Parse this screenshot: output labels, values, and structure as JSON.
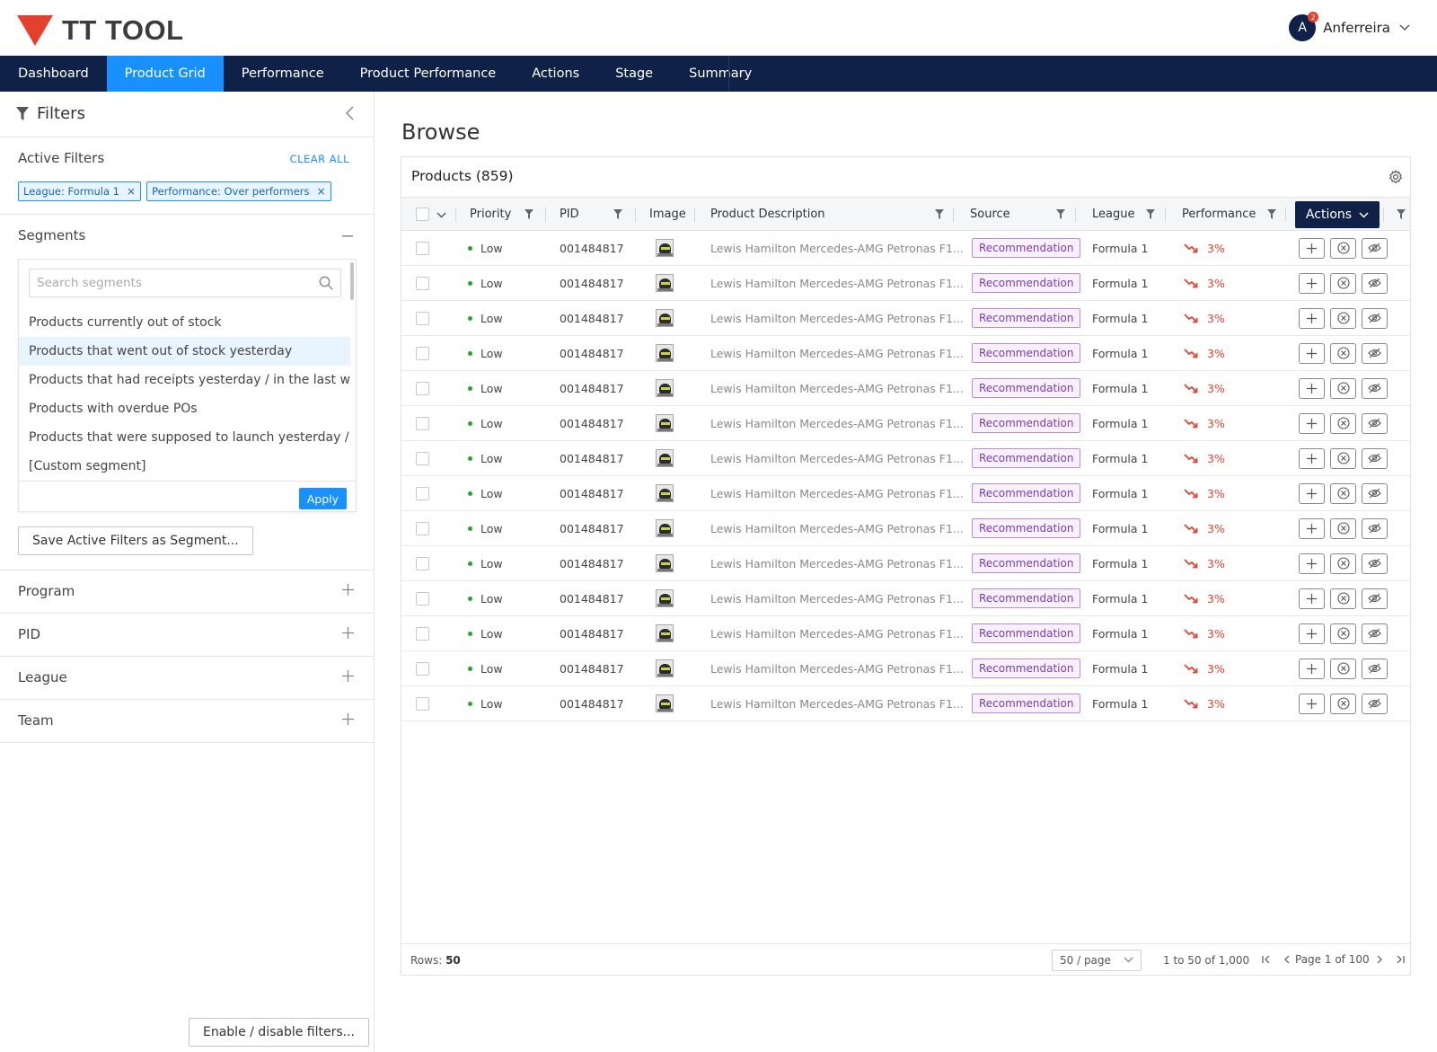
{
  "app": {
    "logo_text": "TT TOOL"
  },
  "user": {
    "initial": "A",
    "name": "Anferreira",
    "notification_count": "2"
  },
  "nav": {
    "items": [
      {
        "label": "Dashboard",
        "active": false
      },
      {
        "label": "Product Grid",
        "active": true
      },
      {
        "label": "Performance",
        "active": false
      },
      {
        "label": "Product Performance",
        "active": false
      },
      {
        "label": "Actions",
        "active": false
      },
      {
        "label": "Stage",
        "active": false
      },
      {
        "label": "Summary",
        "active": false
      }
    ]
  },
  "sidebar": {
    "title": "Filters",
    "active_filters": {
      "title": "Active Filters",
      "clear_label": "CLEAR ALL",
      "chips": [
        "League: Formula 1",
        "Performance: Over performers"
      ]
    },
    "segments": {
      "title": "Segments",
      "search_placeholder": "Search segments",
      "items": [
        {
          "label": "Products currently out of stock",
          "selected": false
        },
        {
          "label": "Products that went out of stock yesterday",
          "selected": true
        },
        {
          "label": "Products that had receipts yesterday / in the last we...",
          "selected": false
        },
        {
          "label": "Products with overdue POs",
          "selected": false
        },
        {
          "label": "Products that were supposed to launch yesterday / i...",
          "selected": false
        },
        {
          "label": "[Custom segment]",
          "selected": false
        }
      ],
      "apply_label": "Apply",
      "save_label": "Save Active Filters as Segment..."
    },
    "sections": [
      "Program",
      "PID",
      "League",
      "Team"
    ],
    "enable_label": "Enable / disable filters..."
  },
  "main": {
    "page_title": "Browse",
    "grid": {
      "title": "Products (859)",
      "columns": {
        "priority": "Priority",
        "pid": "PID",
        "image": "Image",
        "description": "Product Description",
        "source": "Source",
        "league": "League",
        "performance": "Performance",
        "actions": "Actions"
      },
      "rows": [
        {
          "priority": "Low",
          "pid": "001484817",
          "description": "Lewis Hamilton Mercedes-AMG Petronas F1...",
          "source": "Recommendation",
          "league": "Formula 1",
          "performance": "3%"
        },
        {
          "priority": "Low",
          "pid": "001484817",
          "description": "Lewis Hamilton Mercedes-AMG Petronas F1...",
          "source": "Recommendation",
          "league": "Formula 1",
          "performance": "3%"
        },
        {
          "priority": "Low",
          "pid": "001484817",
          "description": "Lewis Hamilton Mercedes-AMG Petronas F1...",
          "source": "Recommendation",
          "league": "Formula 1",
          "performance": "3%"
        },
        {
          "priority": "Low",
          "pid": "001484817",
          "description": "Lewis Hamilton Mercedes-AMG Petronas F1...",
          "source": "Recommendation",
          "league": "Formula 1",
          "performance": "3%"
        },
        {
          "priority": "Low",
          "pid": "001484817",
          "description": "Lewis Hamilton Mercedes-AMG Petronas F1...",
          "source": "Recommendation",
          "league": "Formula 1",
          "performance": "3%"
        },
        {
          "priority": "Low",
          "pid": "001484817",
          "description": "Lewis Hamilton Mercedes-AMG Petronas F1...",
          "source": "Recommendation",
          "league": "Formula 1",
          "performance": "3%"
        },
        {
          "priority": "Low",
          "pid": "001484817",
          "description": "Lewis Hamilton Mercedes-AMG Petronas F1...",
          "source": "Recommendation",
          "league": "Formula 1",
          "performance": "3%"
        },
        {
          "priority": "Low",
          "pid": "001484817",
          "description": "Lewis Hamilton Mercedes-AMG Petronas F1...",
          "source": "Recommendation",
          "league": "Formula 1",
          "performance": "3%"
        },
        {
          "priority": "Low",
          "pid": "001484817",
          "description": "Lewis Hamilton Mercedes-AMG Petronas F1...",
          "source": "Recommendation",
          "league": "Formula 1",
          "performance": "3%"
        },
        {
          "priority": "Low",
          "pid": "001484817",
          "description": "Lewis Hamilton Mercedes-AMG Petronas F1...",
          "source": "Recommendation",
          "league": "Formula 1",
          "performance": "3%"
        },
        {
          "priority": "Low",
          "pid": "001484817",
          "description": "Lewis Hamilton Mercedes-AMG Petronas F1...",
          "source": "Recommendation",
          "league": "Formula 1",
          "performance": "3%"
        },
        {
          "priority": "Low",
          "pid": "001484817",
          "description": "Lewis Hamilton Mercedes-AMG Petronas F1...",
          "source": "Recommendation",
          "league": "Formula 1",
          "performance": "3%"
        },
        {
          "priority": "Low",
          "pid": "001484817",
          "description": "Lewis Hamilton Mercedes-AMG Petronas F1...",
          "source": "Recommendation",
          "league": "Formula 1",
          "performance": "3%"
        },
        {
          "priority": "Low",
          "pid": "001484817",
          "description": "Lewis Hamilton Mercedes-AMG Petronas F1...",
          "source": "Recommendation",
          "league": "Formula 1",
          "performance": "3%"
        }
      ],
      "footer": {
        "rows_label": "Rows:",
        "rows_value": "50",
        "page_size": "50 / page",
        "range": "1 to 50 of 1,000",
        "page_label": "Page 1 of 100"
      }
    }
  },
  "colors": {
    "navy": "#0f2147",
    "accent_blue": "#1890ff",
    "brand_red": "#e4402e",
    "priority_green": "#2aa330",
    "source_purple": "#7a3cb0"
  },
  "icons": {
    "logo": "red-triangle-icon",
    "filter": "funnel-icon",
    "collapse": "chevron-left-icon",
    "segments_toggle": "minus-icon",
    "section_toggle": "plus-icon",
    "search": "search-icon",
    "settings": "gear-icon",
    "performance_trend": "trending-down-icon",
    "row_actions": [
      "plus-icon",
      "circle-x-icon",
      "eye-off-icon"
    ]
  }
}
